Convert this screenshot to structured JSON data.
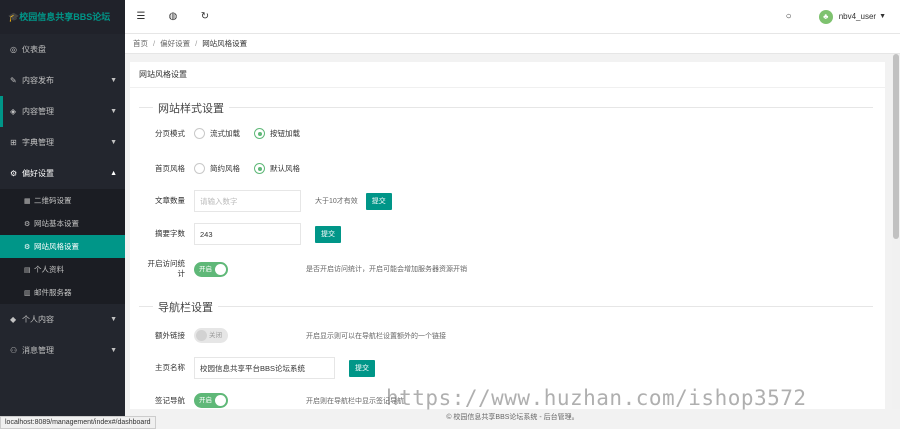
{
  "sidebar": {
    "logo": "🎓校园信息共享BBS论坛",
    "items": [
      {
        "icon": "gauge-icon",
        "glyph": "◎",
        "label": "仪表盘"
      },
      {
        "icon": "pencil-icon",
        "glyph": "✎",
        "label": "内容发布"
      },
      {
        "icon": "layers-icon",
        "glyph": "◈",
        "label": "内容管理"
      },
      {
        "icon": "dictionary-icon",
        "glyph": "⊞",
        "label": "字典管理"
      },
      {
        "icon": "gear-icon",
        "glyph": "⚙",
        "label": "偏好设置"
      },
      {
        "icon": "diamond-icon",
        "glyph": "◆",
        "label": "个人内容"
      },
      {
        "icon": "user-icon",
        "glyph": "⚇",
        "label": "消息管理"
      }
    ],
    "sub_items": [
      {
        "icon": "qrcode-icon",
        "glyph": "▦",
        "label": "二维码设置"
      },
      {
        "icon": "cogs-icon",
        "glyph": "⚙",
        "label": "网站基本设置"
      },
      {
        "icon": "gear-icon",
        "glyph": "⚙",
        "label": "网站风格设置"
      },
      {
        "icon": "profile-icon",
        "glyph": "▤",
        "label": "个人资料"
      },
      {
        "icon": "mail-server-icon",
        "glyph": "▥",
        "label": "邮件服务器"
      }
    ]
  },
  "topbar": {
    "menu_icon": "☰",
    "globe_icon": "◍",
    "refresh_icon": "↻",
    "bell_icon": "○",
    "avatar_glyph": "♣",
    "username": "nbv4_user",
    "caret": "▼"
  },
  "breadcrumb": {
    "home": "首页",
    "sep": "/",
    "level2": "偏好设置",
    "current": "网站风格设置"
  },
  "card": {
    "title": "网站风格设置"
  },
  "style_section": {
    "title": "网站样式设置",
    "paging": {
      "label": "分页模式",
      "options": [
        "流式加载",
        "按钮加载"
      ],
      "selected": 1
    },
    "homepage_style": {
      "label": "首页风格",
      "options": [
        "简约风格",
        "默认风格"
      ],
      "selected": 1
    },
    "article_count": {
      "label": "文章数量",
      "placeholder": "请输入数字",
      "hint": "大于10才有效",
      "button": "提交"
    },
    "summary_chars": {
      "label": "摘要字数",
      "value": "243",
      "button": "提交"
    },
    "stats": {
      "label_line1": "开启访问统",
      "label_line2": "计",
      "switch_text": "开启",
      "hint": "是否开启访问统计，开启可能会增加服务器资源开销"
    }
  },
  "nav_section": {
    "title": "导航栏设置",
    "extra_link": {
      "label": "额外链接",
      "switch_text": "关闭",
      "hint": "开启显示则可以在导航栏设置额外的一个链接"
    },
    "home_name": {
      "label": "主页名称",
      "value": "校园信息共享平台BBS论坛系统",
      "button": "提交"
    },
    "sign_nav": {
      "label": "签记导航",
      "switch_text": "开启",
      "hint": "开启则在导航栏中显示签记导航"
    }
  },
  "footer": {
    "text": "© 校园信息共享BBS论坛系统 - 后台管理。"
  },
  "statusbar": {
    "url": "localhost:8089/management/index#/dashboard"
  },
  "watermark": {
    "text": "https://www.huzhan.com/ishop3572"
  }
}
